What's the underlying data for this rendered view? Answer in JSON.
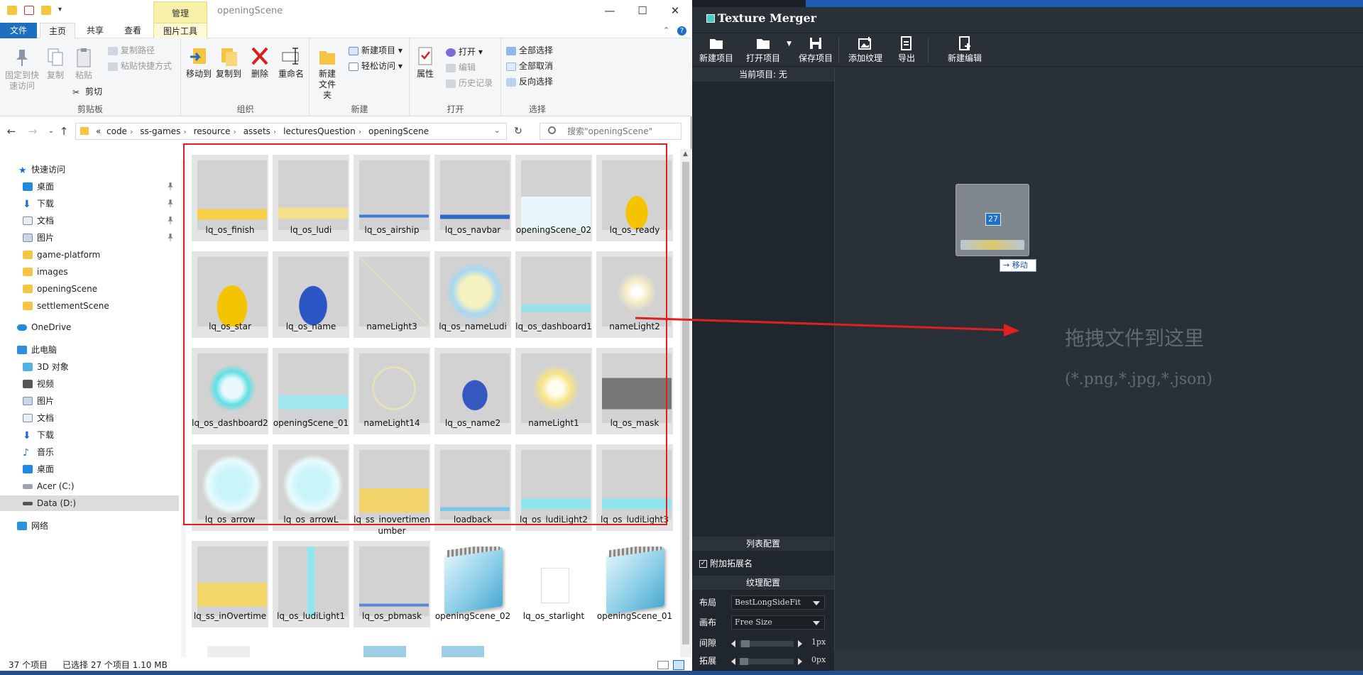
{
  "explorer": {
    "window_title": "openingScene",
    "context_tab_header": "管理",
    "tabs": {
      "file": "文件",
      "home": "主页",
      "share": "共享",
      "view": "查看",
      "picture_tools": "图片工具"
    },
    "ribbon": {
      "clipboard": {
        "label": "剪贴板",
        "pin_quick": "固定到快速访问",
        "copy": "复制",
        "paste": "粘贴",
        "copy_path": "复制路径",
        "paste_shortcut": "粘贴快捷方式",
        "cut": "剪切"
      },
      "organize": {
        "label": "组织",
        "move_to": "移动到",
        "copy_to": "复制到",
        "delete": "删除",
        "rename": "重命名"
      },
      "new": {
        "label": "新建",
        "new_folder": "新建文件夹",
        "new_item": "新建项目",
        "easy_access": "轻松访问"
      },
      "open": {
        "label": "打开",
        "properties": "属性",
        "open": "打开",
        "edit": "编辑",
        "history": "历史记录"
      },
      "select": {
        "label": "选择",
        "select_all": "全部选择",
        "select_none": "全部取消",
        "invert": "反向选择"
      }
    },
    "address": {
      "chevron": "«",
      "crumbs": [
        "code",
        "ss-games",
        "resource",
        "assets",
        "lecturesQuestion",
        "openingScene"
      ]
    },
    "search_placeholder": "搜索\"openingScene\"",
    "nav": {
      "quick_access": "快速访问",
      "desktop": "桌面",
      "downloads": "下载",
      "documents": "文档",
      "pictures": "图片",
      "game_platform": "game-platform",
      "images": "images",
      "opening_scene": "openingScene",
      "settlement_scene": "settlementScene",
      "onedrive": "OneDrive",
      "this_pc": "此电脑",
      "objects_3d": "3D 对象",
      "videos": "视频",
      "pictures2": "图片",
      "documents2": "文档",
      "downloads2": "下载",
      "music": "音乐",
      "desktop2": "桌面",
      "drive_c": "Acer (C:)",
      "drive_d": "Data (D:)",
      "network": "网络"
    },
    "files": [
      "lq_os_finish",
      "lq_os_ludi",
      "lq_os_airship",
      "lq_os_navbar",
      "openingScene_02",
      "lq_os_ready",
      "lq_os_star",
      "lq_os_name",
      "nameLight3",
      "lq_os_nameLudi",
      "lq_os_dashboard1",
      "nameLight2",
      "lq_os_dashboard2",
      "openingScene_01",
      "nameLight14",
      "lq_os_name2",
      "nameLight1",
      "lq_os_mask",
      "lq_os_arrow",
      "lq_os_arrowL",
      "lq_ss_inovertimenumber",
      "loadback",
      "lq_os_ludiLight2",
      "lq_os_ludiLight3",
      "lq_ss_inOvertime",
      "lq_os_ludiLight1",
      "lq_os_pbmask",
      "openingScene_02",
      "lq_os_starlight",
      "openingScene_01"
    ],
    "status": {
      "count": "37 个项目",
      "selected": "已选择 27 个项目  1.10 MB"
    }
  },
  "texture_merger": {
    "title": "Texture Merger",
    "toolbar": {
      "new_project": "新建项目",
      "open_project": "打开项目",
      "save_project": "保存项目",
      "add_texture": "添加纹理",
      "export": "导出",
      "new_edit": "新建编辑"
    },
    "current_project": "当前项目: 无",
    "list_config": "列表配置",
    "append_ext": "附加拓展名",
    "texture_config": "纹理配置",
    "layout_label": "布局",
    "layout_value": "BestLongSideFit",
    "canvas_label": "画布",
    "canvas_value": "Free Size",
    "gap_label": "间隙",
    "gap_value": "1px",
    "extend_label": "拓展",
    "extend_value": "0px",
    "drop_text": "拖拽文件到这里",
    "drop_hint": "(*.png,*.jpg,*.json)",
    "drag_count": "27",
    "drag_action": "→ 移动"
  }
}
